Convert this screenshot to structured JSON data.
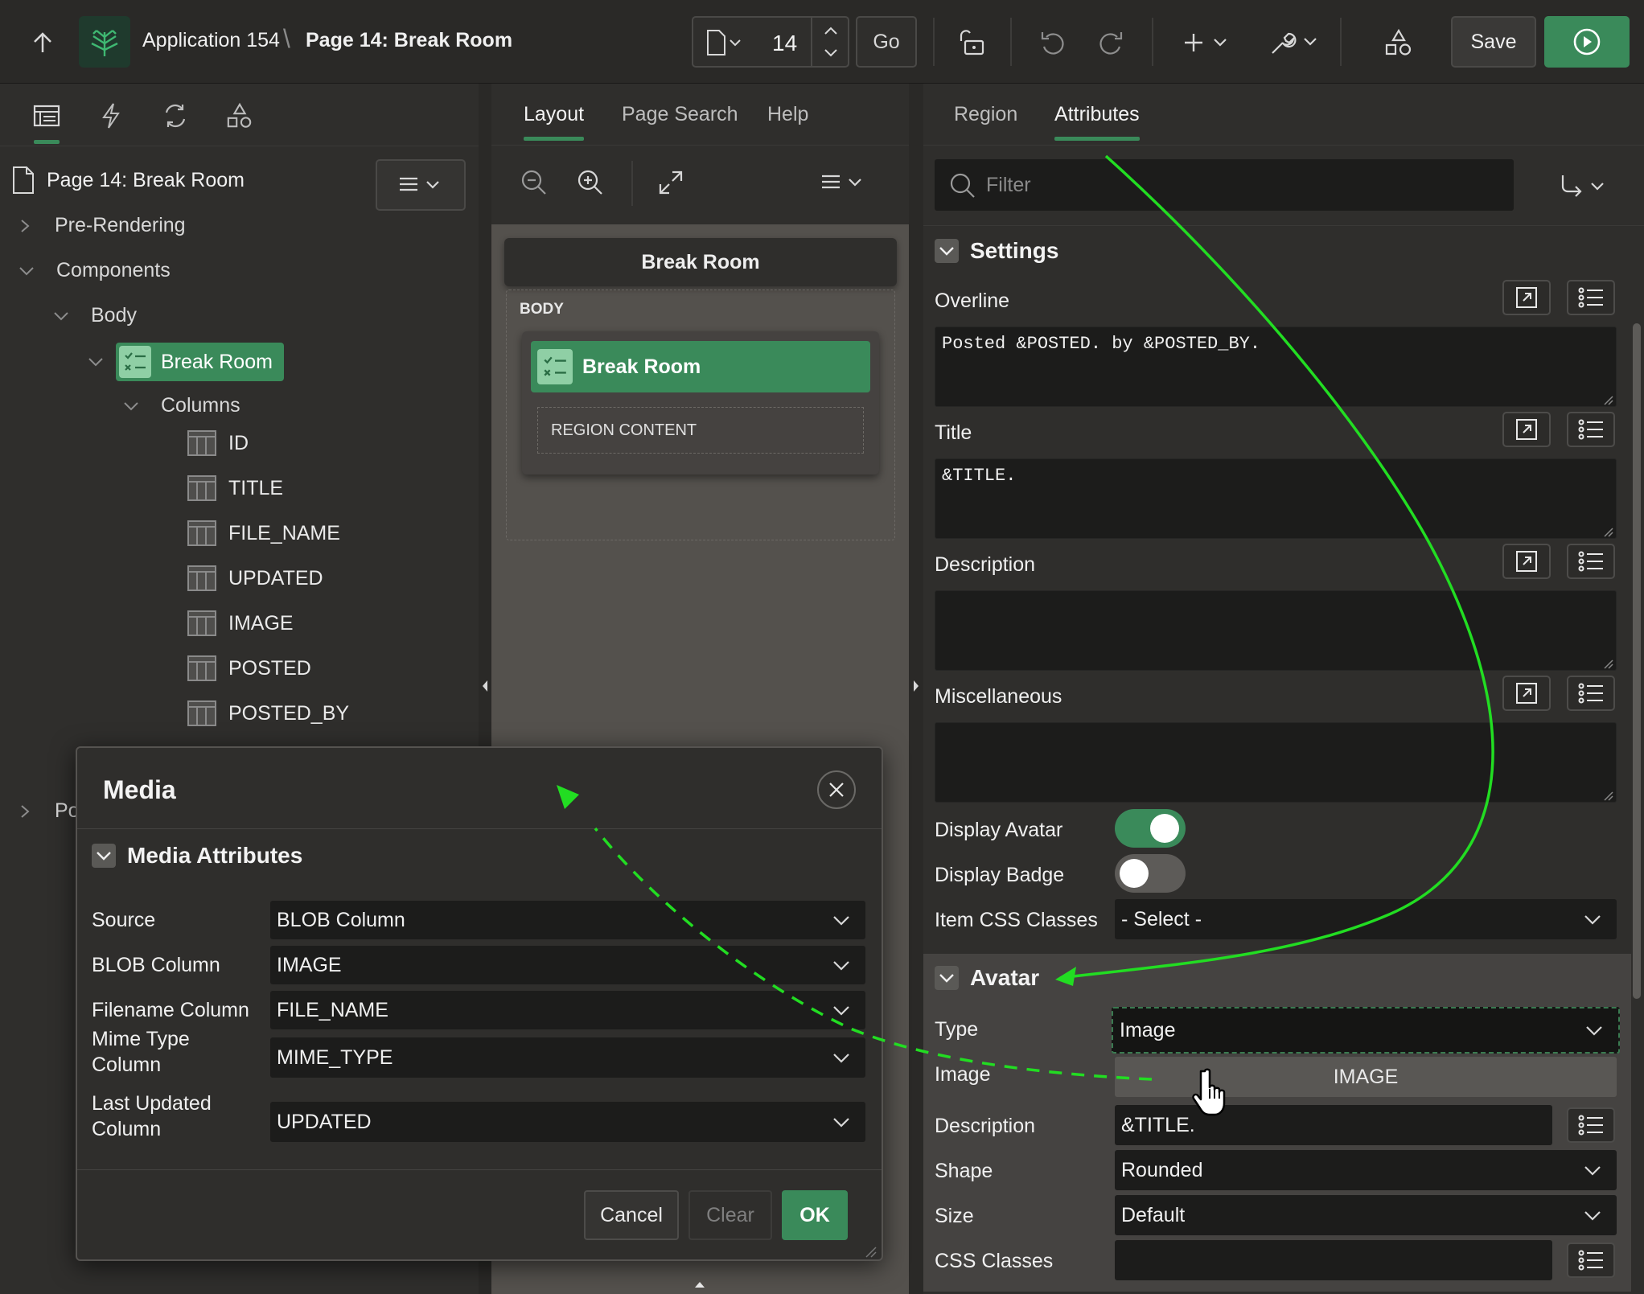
{
  "header": {
    "app_name": "Application 154",
    "page_title": "Page 14: Break Room",
    "page_number": "14",
    "go_label": "Go",
    "save_label": "Save"
  },
  "left_panel": {
    "page_node": "Page 14: Break Room",
    "tree": {
      "pre_rendering": "Pre-Rendering",
      "components": "Components",
      "body": "Body",
      "region": "Break Room",
      "columns": "Columns",
      "column_items": [
        "ID",
        "TITLE",
        "FILE_NAME",
        "UPDATED",
        "IMAGE",
        "POSTED",
        "POSTED_BY"
      ],
      "post_partial": "Po"
    }
  },
  "middle_panel": {
    "tabs": [
      "Layout",
      "Page Search",
      "Help"
    ],
    "canvas": {
      "page_title": "Break Room",
      "body_label": "BODY",
      "region_label": "Break Room",
      "region_content": "REGION CONTENT"
    }
  },
  "right_panel": {
    "tabs": [
      "Region",
      "Attributes"
    ],
    "filter_placeholder": "Filter",
    "settings": {
      "title": "Settings",
      "overline_label": "Overline",
      "overline_value": "Posted &POSTED. by &POSTED_BY.",
      "title_label": "Title",
      "title_value": "&TITLE.",
      "description_label": "Description",
      "description_value": "",
      "misc_label": "Miscellaneous",
      "misc_value": "",
      "display_avatar_label": "Display Avatar",
      "display_badge_label": "Display Badge",
      "item_css_label": "Item CSS Classes",
      "item_css_value": "- Select -"
    },
    "avatar": {
      "title": "Avatar",
      "type_label": "Type",
      "type_value": "Image",
      "image_label": "Image",
      "image_value": "IMAGE",
      "description_label": "Description",
      "description_value": "&TITLE.",
      "shape_label": "Shape",
      "shape_value": "Rounded",
      "size_label": "Size",
      "size_value": "Default",
      "css_label": "CSS Classes",
      "css_value": ""
    }
  },
  "dialog": {
    "title": "Media",
    "section": "Media Attributes",
    "rows": [
      {
        "label": "Source",
        "value": "BLOB Column"
      },
      {
        "label": "BLOB Column",
        "value": "IMAGE"
      },
      {
        "label": "Filename Column",
        "value": "FILE_NAME"
      },
      {
        "label": "Mime Type Column",
        "value": "MIME_TYPE"
      },
      {
        "label": "Last Updated Column",
        "value": "UPDATED"
      }
    ],
    "cancel": "Cancel",
    "clear": "Clear",
    "ok": "OK"
  },
  "colors": {
    "accent_green": "#3a8a5a",
    "annotation_green": "#22dd22",
    "panel_bg": "#2f2e2c",
    "canvas_bg": "#54514d"
  }
}
